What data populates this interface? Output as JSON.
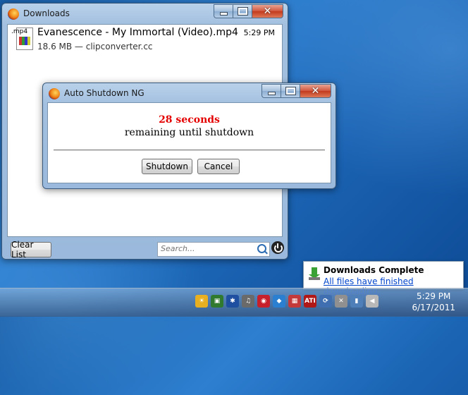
{
  "downloads_window": {
    "title": "Downloads",
    "items": [
      {
        "file_type": ".mp4",
        "name": "Evanescence - My Immortal (Video).mp4",
        "meta": "18.6 MB — clipconverter.cc",
        "time": "5:29 PM"
      }
    ],
    "clear_list_label": "Clear List",
    "search_placeholder": "Search..."
  },
  "shutdown_dialog": {
    "title": "Auto Shutdown NG",
    "countdown": "28 seconds",
    "message": "remaining until shutdown",
    "shutdown_label": "Shutdown",
    "cancel_label": "Cancel",
    "countdown_color": "#e50000"
  },
  "notification": {
    "title": "Downloads Complete",
    "link": "All files have finished downloading."
  },
  "taskbar": {
    "tray_icons": [
      {
        "name": "weather-icon",
        "glyph": "☀",
        "color": "#e8b020"
      },
      {
        "name": "nvidia-icon",
        "glyph": "▣",
        "color": "#2f7a2f"
      },
      {
        "name": "bluetooth-icon",
        "glyph": "✱",
        "color": "#1f4fa0"
      },
      {
        "name": "media-icon",
        "glyph": "♫",
        "color": "#6a6a6a"
      },
      {
        "name": "opera-icon",
        "glyph": "◉",
        "color": "#c8202a"
      },
      {
        "name": "dropbox-icon",
        "glyph": "◆",
        "color": "#2b7fd0"
      },
      {
        "name": "gift-icon",
        "glyph": "▦",
        "color": "#c43a3a"
      },
      {
        "name": "ati-icon",
        "glyph": "ATI",
        "color": "#b01818"
      },
      {
        "name": "sync-icon",
        "glyph": "⟳",
        "color": "#3f6fb0"
      },
      {
        "name": "network-error-icon",
        "glyph": "✕",
        "color": "#909090"
      },
      {
        "name": "signal-icon",
        "glyph": "▮",
        "color": "#4f7fb8"
      },
      {
        "name": "volume-icon",
        "glyph": "◀",
        "color": "#b8b8b8"
      }
    ],
    "clock_time": "5:29 PM",
    "clock_date": "6/17/2011"
  }
}
